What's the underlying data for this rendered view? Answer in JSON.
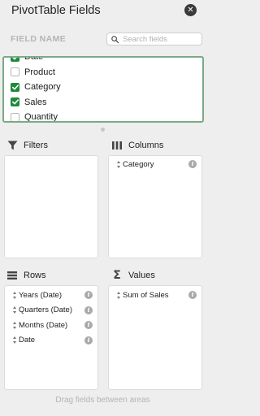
{
  "panel": {
    "title": "PivotTable Fields",
    "close_icon": "close-icon"
  },
  "field_list": {
    "heading": "FIELD NAME",
    "search_placeholder": "Search fields",
    "fields": [
      {
        "label": "Date",
        "checked": true
      },
      {
        "label": "Product",
        "checked": false
      },
      {
        "label": "Category",
        "checked": true
      },
      {
        "label": "Sales",
        "checked": true
      },
      {
        "label": "Quantity",
        "checked": false
      }
    ]
  },
  "areas": {
    "filters": {
      "label": "Filters",
      "icon": "filter-icon",
      "items": []
    },
    "columns": {
      "label": "Columns",
      "icon": "columns-icon",
      "items": [
        "Category"
      ]
    },
    "rows": {
      "label": "Rows",
      "icon": "rows-icon",
      "items": [
        "Years (Date)",
        "Quarters (Date)",
        "Months (Date)",
        "Date"
      ]
    },
    "values": {
      "label": "Values",
      "icon": "sigma-icon",
      "items": [
        "Sum of Sales"
      ]
    }
  },
  "footer": {
    "hint": "Drag fields between areas"
  },
  "colors": {
    "check_green": "#1e8a3a",
    "list_border": "#7aaa86",
    "panel_bg": "#eeeeee"
  }
}
